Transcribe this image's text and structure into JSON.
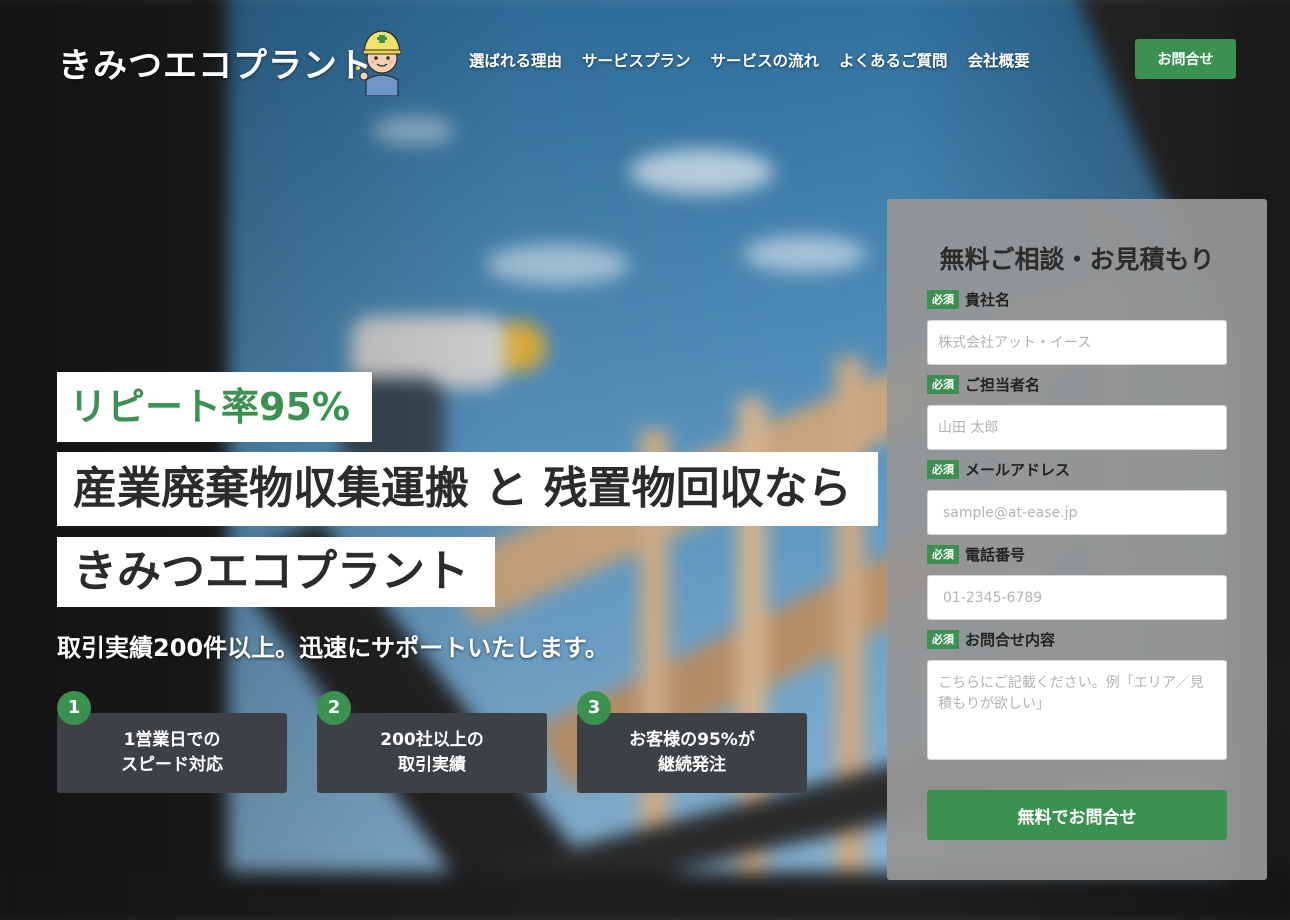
{
  "header": {
    "logo": "きみつエコプラント",
    "nav": [
      "選ばれる理由",
      "サービスプラン",
      "サービスの流れ",
      "よくあるご質問",
      "会社概要"
    ],
    "contact_button": "お問合せ"
  },
  "hero": {
    "tag": "リピート率95%",
    "headline_line1": "産業廃棄物収集運搬 と 残置物回収なら",
    "headline_line2": "きみつエコプラント",
    "lead": "取引実績200件以上。迅速にサポートいたします。",
    "features": [
      {
        "number": "1",
        "line1": "1営業日での",
        "line2": "スピード対応"
      },
      {
        "number": "2",
        "line1": "200社以上の",
        "line2": "取引実績"
      },
      {
        "number": "3",
        "line1": "お客様の95%が",
        "line2": "継続発注"
      }
    ]
  },
  "form": {
    "title": "無料ご相談・お見積もり",
    "required_label": "必須",
    "fields": [
      {
        "label": "貴社名",
        "placeholder": "株式会社アット・イース"
      },
      {
        "label": "ご担当者名",
        "placeholder": "山田 太郎"
      },
      {
        "label": "メールアドレス",
        "placeholder": "sample@at-ease.jp"
      },
      {
        "label": "電話番号",
        "placeholder": "01-2345-6789"
      },
      {
        "label": "お問合せ内容",
        "placeholder": "こちらにご記載ください。例「エリア／見積もりが欲しい」"
      }
    ],
    "submit": "無料でお問合せ"
  },
  "colors": {
    "accent": "#3a9150",
    "dark_box": "#3d4146",
    "form_panel": "#969696"
  }
}
